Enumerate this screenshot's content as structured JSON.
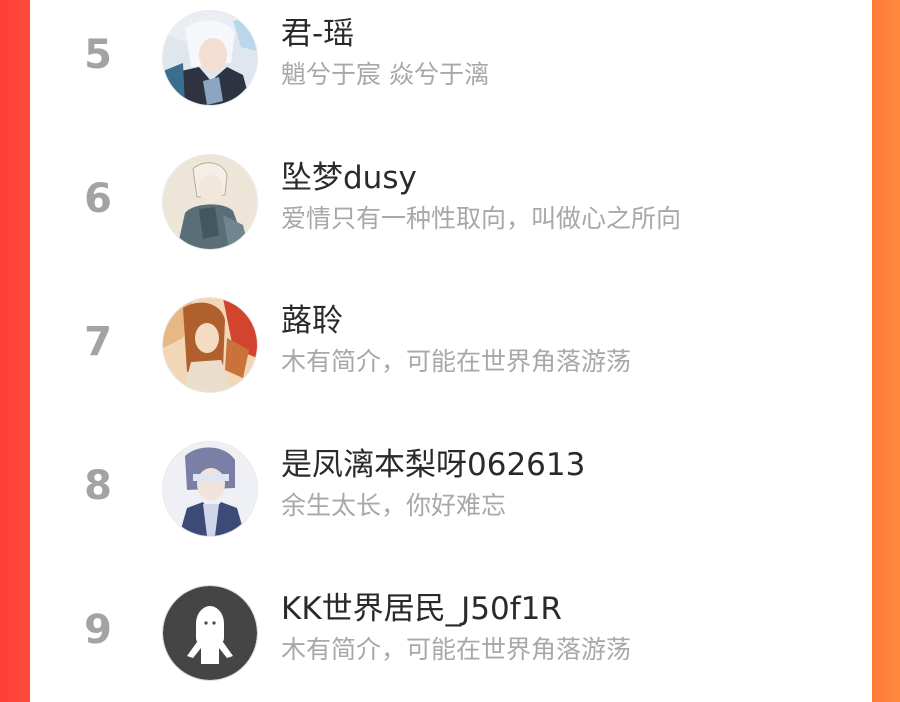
{
  "ranking": {
    "items": [
      {
        "rank": "5",
        "name": "君-瑶",
        "bio": "魈兮于宸 焱兮于漓",
        "avatar": "anime-avatar-icon"
      },
      {
        "rank": "6",
        "name": "坠梦dusy",
        "bio": "爱情只有一种性取向，叫做心之所向",
        "avatar": "anime-avatar-icon"
      },
      {
        "rank": "7",
        "name": "蕗聆",
        "bio": "木有简介，可能在世界角落游荡",
        "avatar": "anime-avatar-icon"
      },
      {
        "rank": "8",
        "name": "是凤漓本梨呀062613",
        "bio": "余生太长，你好难忘",
        "avatar": "anime-avatar-icon"
      },
      {
        "rank": "9",
        "name": "KK世界居民_J50f1R",
        "bio": "木有简介，可能在世界角落游荡",
        "avatar": "default-user-avatar-icon"
      }
    ]
  },
  "colors": {
    "frame_left": "#ff3d3a",
    "frame_right": "#ff8a3c",
    "rank_text": "#a3a3a3",
    "name_text": "#2a2a2a",
    "bio_text": "#a8a8a8"
  }
}
